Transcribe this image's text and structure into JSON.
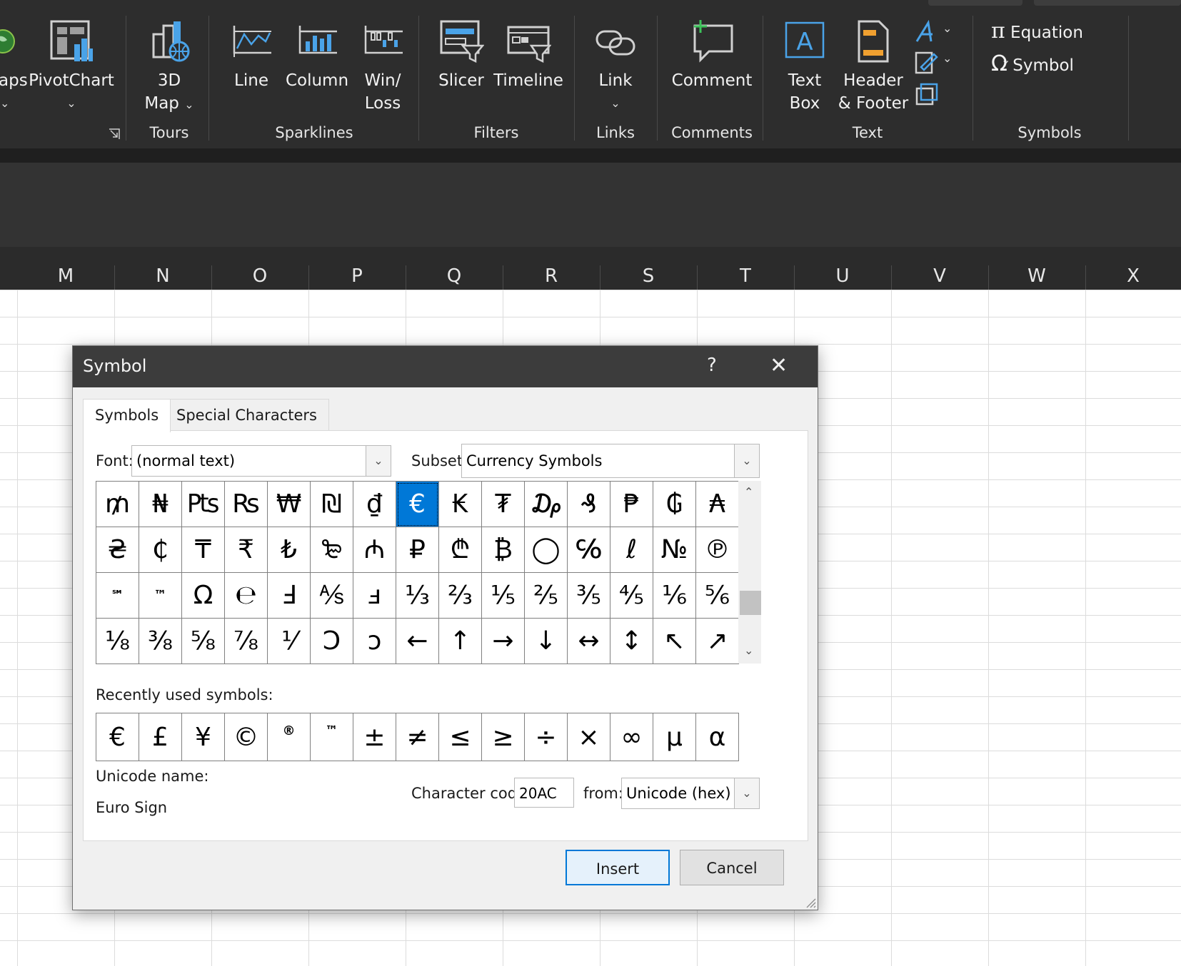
{
  "ribbon": {
    "maps_partial": "aps",
    "pivotchart": "PivotChart",
    "map3d_line1": "3D",
    "map3d_line2": "Map",
    "tours_label": "Tours",
    "sparklines": {
      "line": "Line",
      "column": "Column",
      "winloss_line1": "Win/",
      "winloss_line2": "Loss",
      "label": "Sparklines"
    },
    "filters": {
      "slicer": "Slicer",
      "timeline": "Timeline",
      "label": "Filters"
    },
    "links": {
      "link": "Link",
      "label": "Links"
    },
    "comments": {
      "comment": "Comment",
      "label": "Comments"
    },
    "text": {
      "textbox_line1": "Text",
      "textbox_line2": "Box",
      "header_line1": "Header",
      "header_line2": "& Footer",
      "label": "Text"
    },
    "symbols": {
      "equation": "Equation",
      "symbol": "Symbol",
      "label": "Symbols"
    }
  },
  "columns": [
    "M",
    "N",
    "O",
    "P",
    "Q",
    "R",
    "S",
    "T",
    "U",
    "V",
    "W",
    "X"
  ],
  "dialog": {
    "title": "Symbol",
    "help": "?",
    "close": "✕",
    "tabs": [
      "Symbols",
      "Special Characters"
    ],
    "font_label": "Font:",
    "font_value": "(normal text)",
    "subset_label": "Subset:",
    "subset_value": "Currency Symbols",
    "symbols": [
      [
        "₥",
        "₦",
        "₧",
        "₨",
        "₩",
        "₪",
        "₫",
        "€",
        "₭",
        "₮",
        "₯",
        "₰",
        "₱",
        "₲",
        "₳"
      ],
      [
        "₴",
        "₵",
        "₸",
        "₹",
        "₺",
        "₻",
        "₼",
        "₽",
        "₾",
        "₿",
        "◯",
        "℅",
        "ℓ",
        "№",
        "℗"
      ],
      [
        "℠",
        "™",
        "Ω",
        "℮",
        "Ⅎ",
        "⅍",
        "ⅎ",
        "⅓",
        "⅔",
        "⅕",
        "⅖",
        "⅗",
        "⅘",
        "⅙",
        "⅚"
      ],
      [
        "⅛",
        "⅜",
        "⅝",
        "⅞",
        "⅟",
        "Ↄ",
        "ↄ",
        "←",
        "↑",
        "→",
        "↓",
        "↔",
        "↕",
        "↖",
        "↗"
      ]
    ],
    "selected_symbol": "€",
    "recent_label": "Recently used symbols:",
    "recent": [
      "€",
      "£",
      "¥",
      "©",
      "®",
      "™",
      "±",
      "≠",
      "≤",
      "≥",
      "÷",
      "×",
      "∞",
      "µ",
      "α"
    ],
    "unicode_name_label": "Unicode name:",
    "unicode_name": "Euro Sign",
    "char_code_label": "Character code:",
    "char_code": "20AC",
    "from_label": "from:",
    "from_value": "Unicode (hex)",
    "insert": "Insert",
    "cancel": "Cancel"
  },
  "colors": {
    "accent": "#0078d7",
    "ribbon_bg": "#2d2d2d",
    "dialog_bg": "#f0f0f0"
  }
}
